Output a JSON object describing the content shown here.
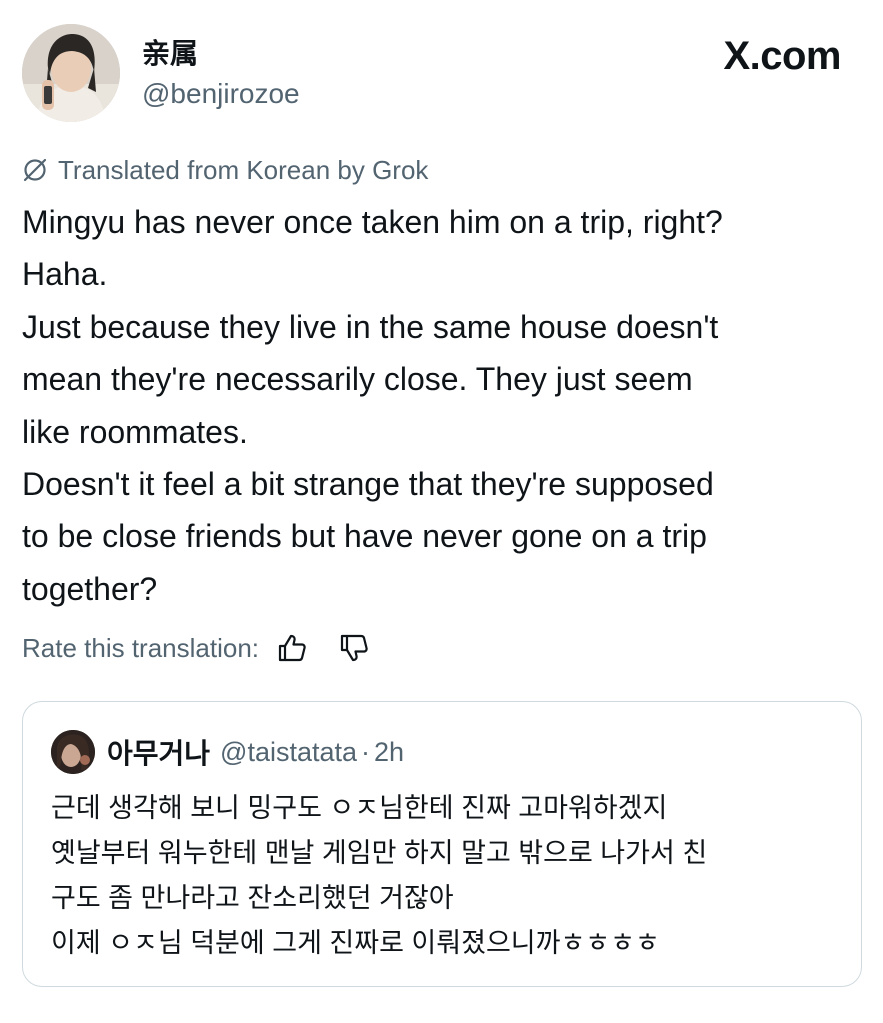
{
  "author": {
    "display_name": "亲属",
    "handle": "@benjirozoe"
  },
  "site_logo": "X.com",
  "translation": {
    "label": "Translated from Korean by Grok",
    "icon": "grok-icon"
  },
  "tweet": {
    "lines": [
      "Mingyu has never once taken him on a trip, right?",
      "Haha.",
      "Just because they live in the same house doesn't",
      "mean they're necessarily close. They just seem",
      "like roommates.",
      "Doesn't it feel a bit strange that they're supposed",
      "to be close friends but have never gone on a trip",
      "together?"
    ]
  },
  "rate": {
    "label": "Rate this translation:",
    "up_icon": "thumbs-up-icon",
    "down_icon": "thumbs-down-icon"
  },
  "quote": {
    "display_name": "아무거나",
    "handle": "@taistatata",
    "separator": "·",
    "time": "2h",
    "lines": [
      "근데 생각해 보니 밍구도 ㅇㅈ님한테 진짜 고마워하겠지",
      "옛날부터 워누한테 맨날 게임만 하지 말고 밖으로 나가서 친",
      "구도 좀 만나라고 잔소리했던 거잖아",
      "이제 ㅇㅈ님 덕분에 그게 진짜로 이뤄졌으니까ㅎㅎㅎㅎ"
    ]
  },
  "colors": {
    "text": "#0f1419",
    "secondary": "#536471",
    "border": "#cfd9de"
  }
}
